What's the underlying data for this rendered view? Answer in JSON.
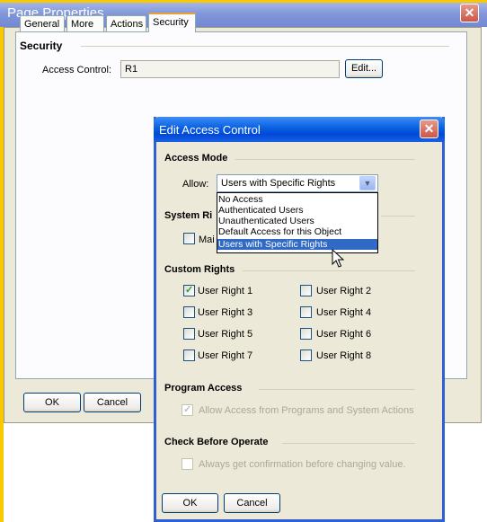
{
  "outer_window": {
    "title": "Page Properties",
    "close_glyph": "✕",
    "tabs": [
      {
        "label": "General",
        "active": false
      },
      {
        "label": "More",
        "active": false
      },
      {
        "label": "Actions",
        "active": false
      },
      {
        "label": "Security",
        "active": true
      }
    ],
    "security": {
      "heading": "Security",
      "access_control_label": "Access Control:",
      "access_control_value": "R1",
      "edit_label": "Edit..."
    },
    "ok_label": "OK",
    "cancel_label": "Cancel"
  },
  "edit_dialog": {
    "title": "Edit Access Control",
    "close_glyph": "✕",
    "access_mode": {
      "heading": "Access Mode",
      "allow_label": "Allow:",
      "selected": "Users with Specific Rights",
      "arrow_glyph": "▼",
      "options": [
        "No Access",
        "Authenticated Users",
        "Unauthenticated Users",
        "Default Access for this Object",
        "Users with Specific Rights"
      ],
      "highlighted_index": 4
    },
    "system_rights": {
      "heading": "System Ri",
      "maintain_label": "Mai",
      "maintain_checked": false
    },
    "custom_rights": {
      "heading": "Custom Rights",
      "rights": [
        {
          "label": "User Right 1",
          "checked": true
        },
        {
          "label": "User Right 2",
          "checked": false
        },
        {
          "label": "User Right 3",
          "checked": false
        },
        {
          "label": "User Right 4",
          "checked": false
        },
        {
          "label": "User Right 5",
          "checked": false
        },
        {
          "label": "User Right 6",
          "checked": false
        },
        {
          "label": "User Right 7",
          "checked": false
        },
        {
          "label": "User Right 8",
          "checked": false
        }
      ]
    },
    "program_access": {
      "heading": "Program Access",
      "option_label": "Allow Access from Programs and System Actions",
      "checked": true,
      "enabled": false
    },
    "check_before_operate": {
      "heading": "Check Before Operate",
      "option_label": "Always get confirmation before changing value.",
      "checked": false,
      "enabled": false
    },
    "ok_label": "OK",
    "cancel_label": "Cancel"
  },
  "colors": {
    "outer_title_bar": "#7f95d8",
    "inner_title_bar": "#0a5fe0",
    "dialog_face": "#ece9d8",
    "selection_highlight": "#316ac5",
    "active_tab_accent": "#e7a036"
  }
}
